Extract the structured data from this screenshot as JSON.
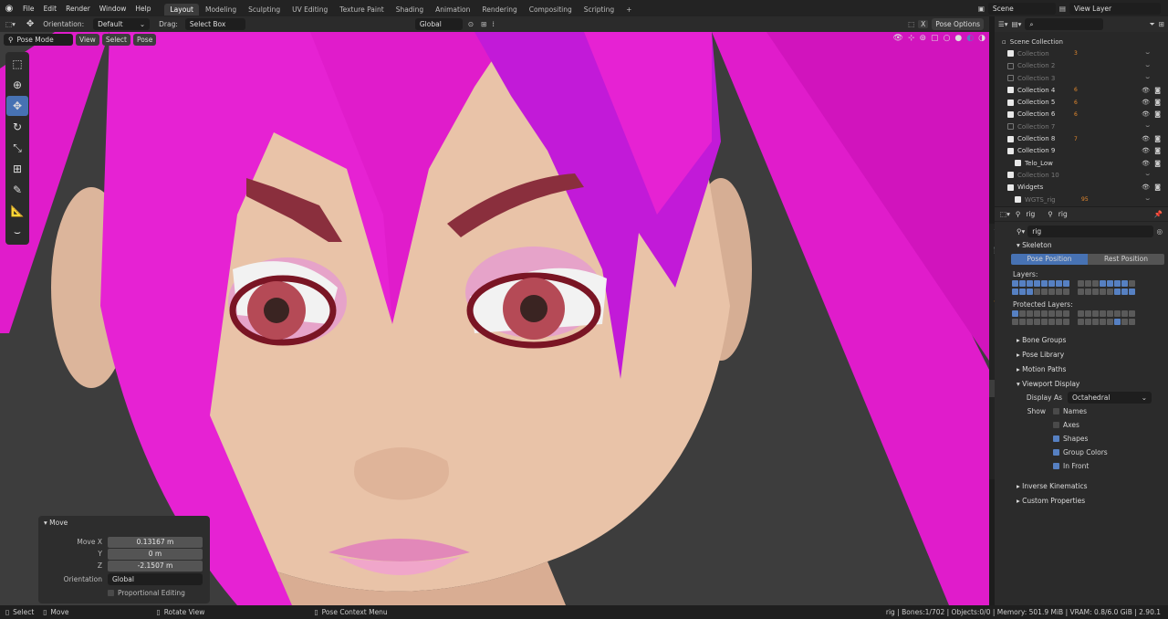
{
  "topbar": {
    "menus": [
      "File",
      "Edit",
      "Render",
      "Window",
      "Help"
    ],
    "workspaces": [
      "Layout",
      "Modeling",
      "Sculpting",
      "UV Editing",
      "Texture Paint",
      "Shading",
      "Animation",
      "Rendering",
      "Compositing",
      "Scripting"
    ],
    "active_workspace": "Layout",
    "add_tab": "+",
    "scene": "Scene",
    "view_layer": "View Layer"
  },
  "vp_header": {
    "orientation_label": "Orientation:",
    "orientation_value": "Default",
    "drag_label": "Drag:",
    "drag_value": "Select Box",
    "transform_value": "Global",
    "pose_options": "Pose Options"
  },
  "mode_row": {
    "mode": "Pose Mode",
    "view": "View",
    "select": "Select",
    "pose": "Pose"
  },
  "move_panel": {
    "title": "Move",
    "move_x_label": "Move X",
    "move_x": "0.13167 m",
    "y_label": "Y",
    "y": "0 m",
    "z_label": "Z",
    "z": "-2.1507 m",
    "orientation_label": "Orientation",
    "orientation_value": "Global",
    "proportional": "Proportional Editing"
  },
  "outliner": {
    "root": "Scene Collection",
    "rows": [
      {
        "name": "Collection",
        "enabled": true,
        "dim": true,
        "count": "3",
        "eye": false
      },
      {
        "name": "Collection 2",
        "enabled": false,
        "dim": true,
        "count": "",
        "eye": false
      },
      {
        "name": "Collection 3",
        "enabled": false,
        "dim": true,
        "count": "",
        "eye": false
      },
      {
        "name": "Collection 4",
        "enabled": true,
        "dim": false,
        "count": "6",
        "eye": true
      },
      {
        "name": "Collection 5",
        "enabled": true,
        "dim": false,
        "count": "6",
        "eye": true
      },
      {
        "name": "Collection 6",
        "enabled": true,
        "dim": false,
        "count": "6",
        "eye": true
      },
      {
        "name": "Collection 7",
        "enabled": false,
        "dim": true,
        "count": "",
        "eye": false
      },
      {
        "name": "Collection 8",
        "enabled": true,
        "dim": false,
        "count": "7",
        "eye": true
      },
      {
        "name": "Collection 9",
        "enabled": true,
        "dim": false,
        "count": "",
        "eye": true
      },
      {
        "name": "Telo_Low",
        "enabled": true,
        "dim": false,
        "count": "",
        "eye": true
      },
      {
        "name": "Collection 10",
        "enabled": true,
        "dim": true,
        "count": "",
        "eye": false
      },
      {
        "name": "Widgets",
        "enabled": true,
        "dim": false,
        "count": "",
        "eye": true
      },
      {
        "name": "WGTS_rig",
        "enabled": true,
        "dim": true,
        "count": "95",
        "eye": false
      }
    ]
  },
  "props": {
    "breadcrumb_obj": "rig",
    "breadcrumb_data": "rig",
    "data_name": "rig",
    "skeleton": "Skeleton",
    "pose_position": "Pose Position",
    "rest_position": "Rest Position",
    "layers": "Layers:",
    "protected_layers": "Protected Layers:",
    "bone_groups": "Bone Groups",
    "pose_library": "Pose Library",
    "motion_paths": "Motion Paths",
    "viewport_display": "Viewport Display",
    "display_as_label": "Display As",
    "display_as": "Octahedral",
    "show_label": "Show",
    "names": "Names",
    "axes": "Axes",
    "shapes": "Shapes",
    "group_colors": "Group Colors",
    "in_front": "In Front",
    "inverse_kinematics": "Inverse Kinematics",
    "custom_properties": "Custom Properties"
  },
  "statusbar": {
    "select": "Select",
    "move": "Move",
    "rotate_view": "Rotate View",
    "context_menu": "Pose Context Menu",
    "stats": "rig | Bones:1/702 | Objects:0/0 | Memory: 501.9 MiB | VRAM: 0.8/6.0 GiB | 2.90.1"
  },
  "colors": {
    "accent": "#4772b3",
    "hair": "#e81ed0",
    "skin": "#eac3a8",
    "lips": "#e07fb4"
  }
}
